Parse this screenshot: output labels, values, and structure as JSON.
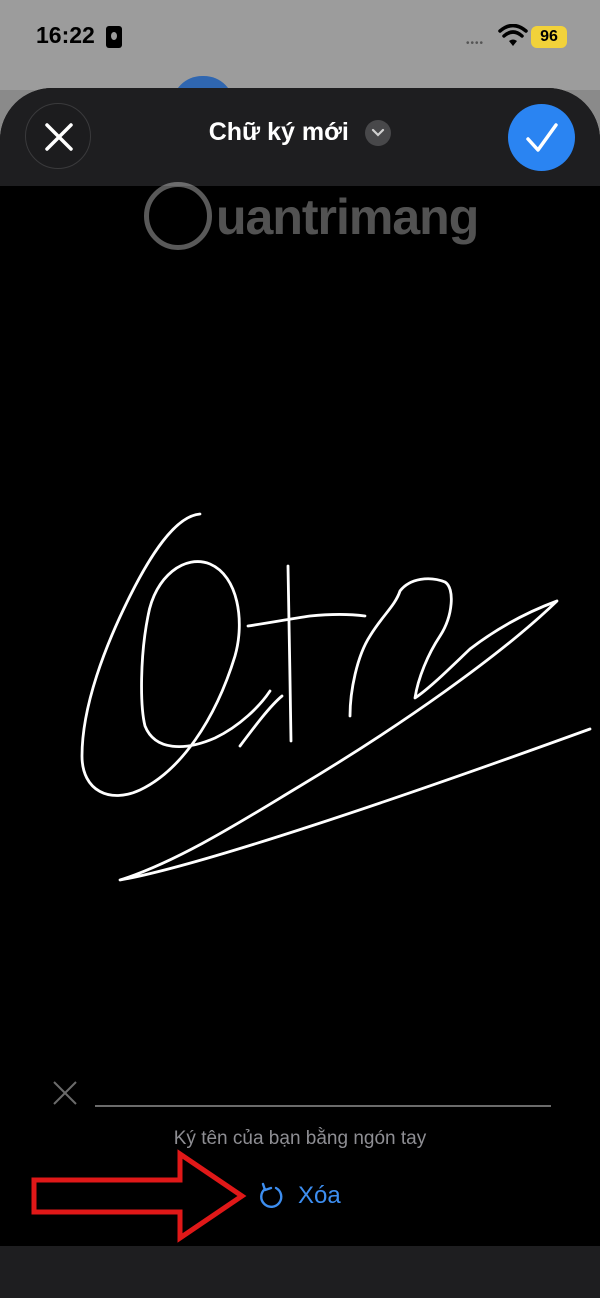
{
  "status_bar": {
    "time": "16:22",
    "battery": "96",
    "signal": "••••"
  },
  "sheet": {
    "title": "Chữ ký mới",
    "hint": "Ký tên của bạn bằng ngón tay",
    "clear_label": "Xóa"
  },
  "watermark": {
    "text": "uantrimang"
  },
  "colors": {
    "accent": "#2a84f2",
    "link": "#3d8ef0",
    "annotation_arrow": "#e01818",
    "battery": "#f2d23a"
  },
  "icons": {
    "close": "close-icon",
    "confirm": "checkmark-icon",
    "expand": "chevron-down-icon",
    "clear": "undo-icon",
    "wifi": "wifi-icon"
  }
}
